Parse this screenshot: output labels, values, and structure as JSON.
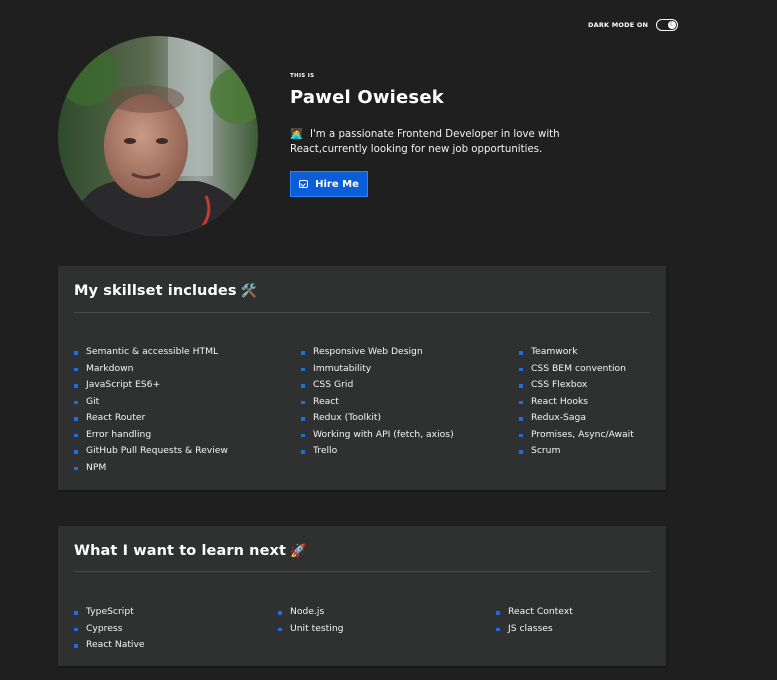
{
  "header": {
    "dark_mode_label": "DARK MODE ON",
    "toggle_icon": "moon-icon"
  },
  "profile": {
    "this_is": "THIS IS",
    "name": "Pawel Owiesek",
    "description": "I'm a passionate Frontend Developer in love with React,currently looking for new job opportunities.",
    "hire_label": "Hire Me"
  },
  "skills": {
    "title": "My skillset includes",
    "title_emoji": "🛠️",
    "col1": [
      "Semantic & accessible HTML",
      "Markdown",
      "JavaScript ES6+",
      "Git",
      "React Router",
      "Error handling",
      "GitHub Pull Requests & Review",
      "NPM"
    ],
    "col2": [
      "Responsive Web Design",
      "Immutability",
      "CSS Grid",
      "React",
      "Redux (Toolkit)",
      "Working with API (fetch, axios)",
      "Trello"
    ],
    "col3": [
      "Teamwork",
      "CSS BEM convention",
      "CSS Flexbox",
      "React Hooks",
      "Redux-Saga",
      "Promises, Async/Await",
      "Scrum"
    ]
  },
  "learn": {
    "title": "What I want to learn next",
    "title_emoji": "🚀",
    "col1": [
      "TypeScript",
      "Cypress",
      "React Native"
    ],
    "col2": [
      "Node.js",
      "Unit testing"
    ],
    "col3": [
      "React Context",
      "JS classes"
    ]
  },
  "colors": {
    "background": "#1f1f1f",
    "card": "#2f3030",
    "accent": "#0b5ed7",
    "bullet": "#1d6fe0"
  }
}
